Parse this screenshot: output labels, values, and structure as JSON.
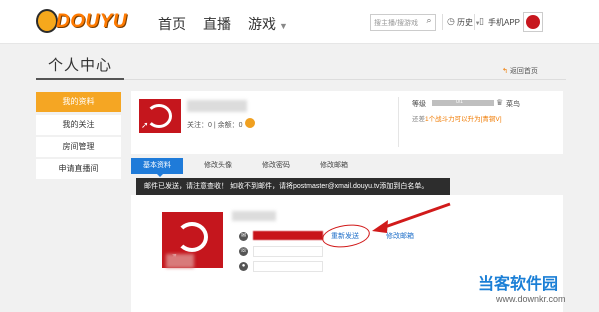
{
  "header": {
    "logo_text": "DOUYU",
    "nav": [
      "首页",
      "直播",
      "游戏"
    ],
    "search_placeholder": "搜主播/搜游戏",
    "history_label": "历史",
    "app_label": "手机APP"
  },
  "page": {
    "title": "个人中心",
    "back_link": "返回首页"
  },
  "sidebar": {
    "items": [
      {
        "label": "我的资料",
        "active": true
      },
      {
        "label": "我的关注",
        "active": false
      },
      {
        "label": "房间管理",
        "active": false
      },
      {
        "label": "申请直播间",
        "active": false
      }
    ]
  },
  "profile": {
    "follow_text": "关注：0",
    "balance_text": "余额：0",
    "level_label": "等级",
    "level_progress": "0/1",
    "level_name": "菜鸟",
    "level_hint_prefix": "还差",
    "level_hint_highlight": "1个战斗力可以升为",
    "level_hint_target": "[青铜V]"
  },
  "tabs": [
    "基本资料",
    "修改头像",
    "修改密码",
    "修改邮箱"
  ],
  "notice": "邮件已发送，请注意查收！ 如收不到邮件，请将postmaster@xmail.douyu.tv添加到白名单。",
  "email_row": {
    "resend_label": "重新发送",
    "change_email_label": "修改邮箱"
  },
  "watermark": {
    "name": "当客软件园",
    "url": "www.downkr.com"
  },
  "colors": {
    "accent_orange": "#f5a623",
    "tab_blue": "#1f7bd9",
    "alert_red": "#d11a1a"
  }
}
